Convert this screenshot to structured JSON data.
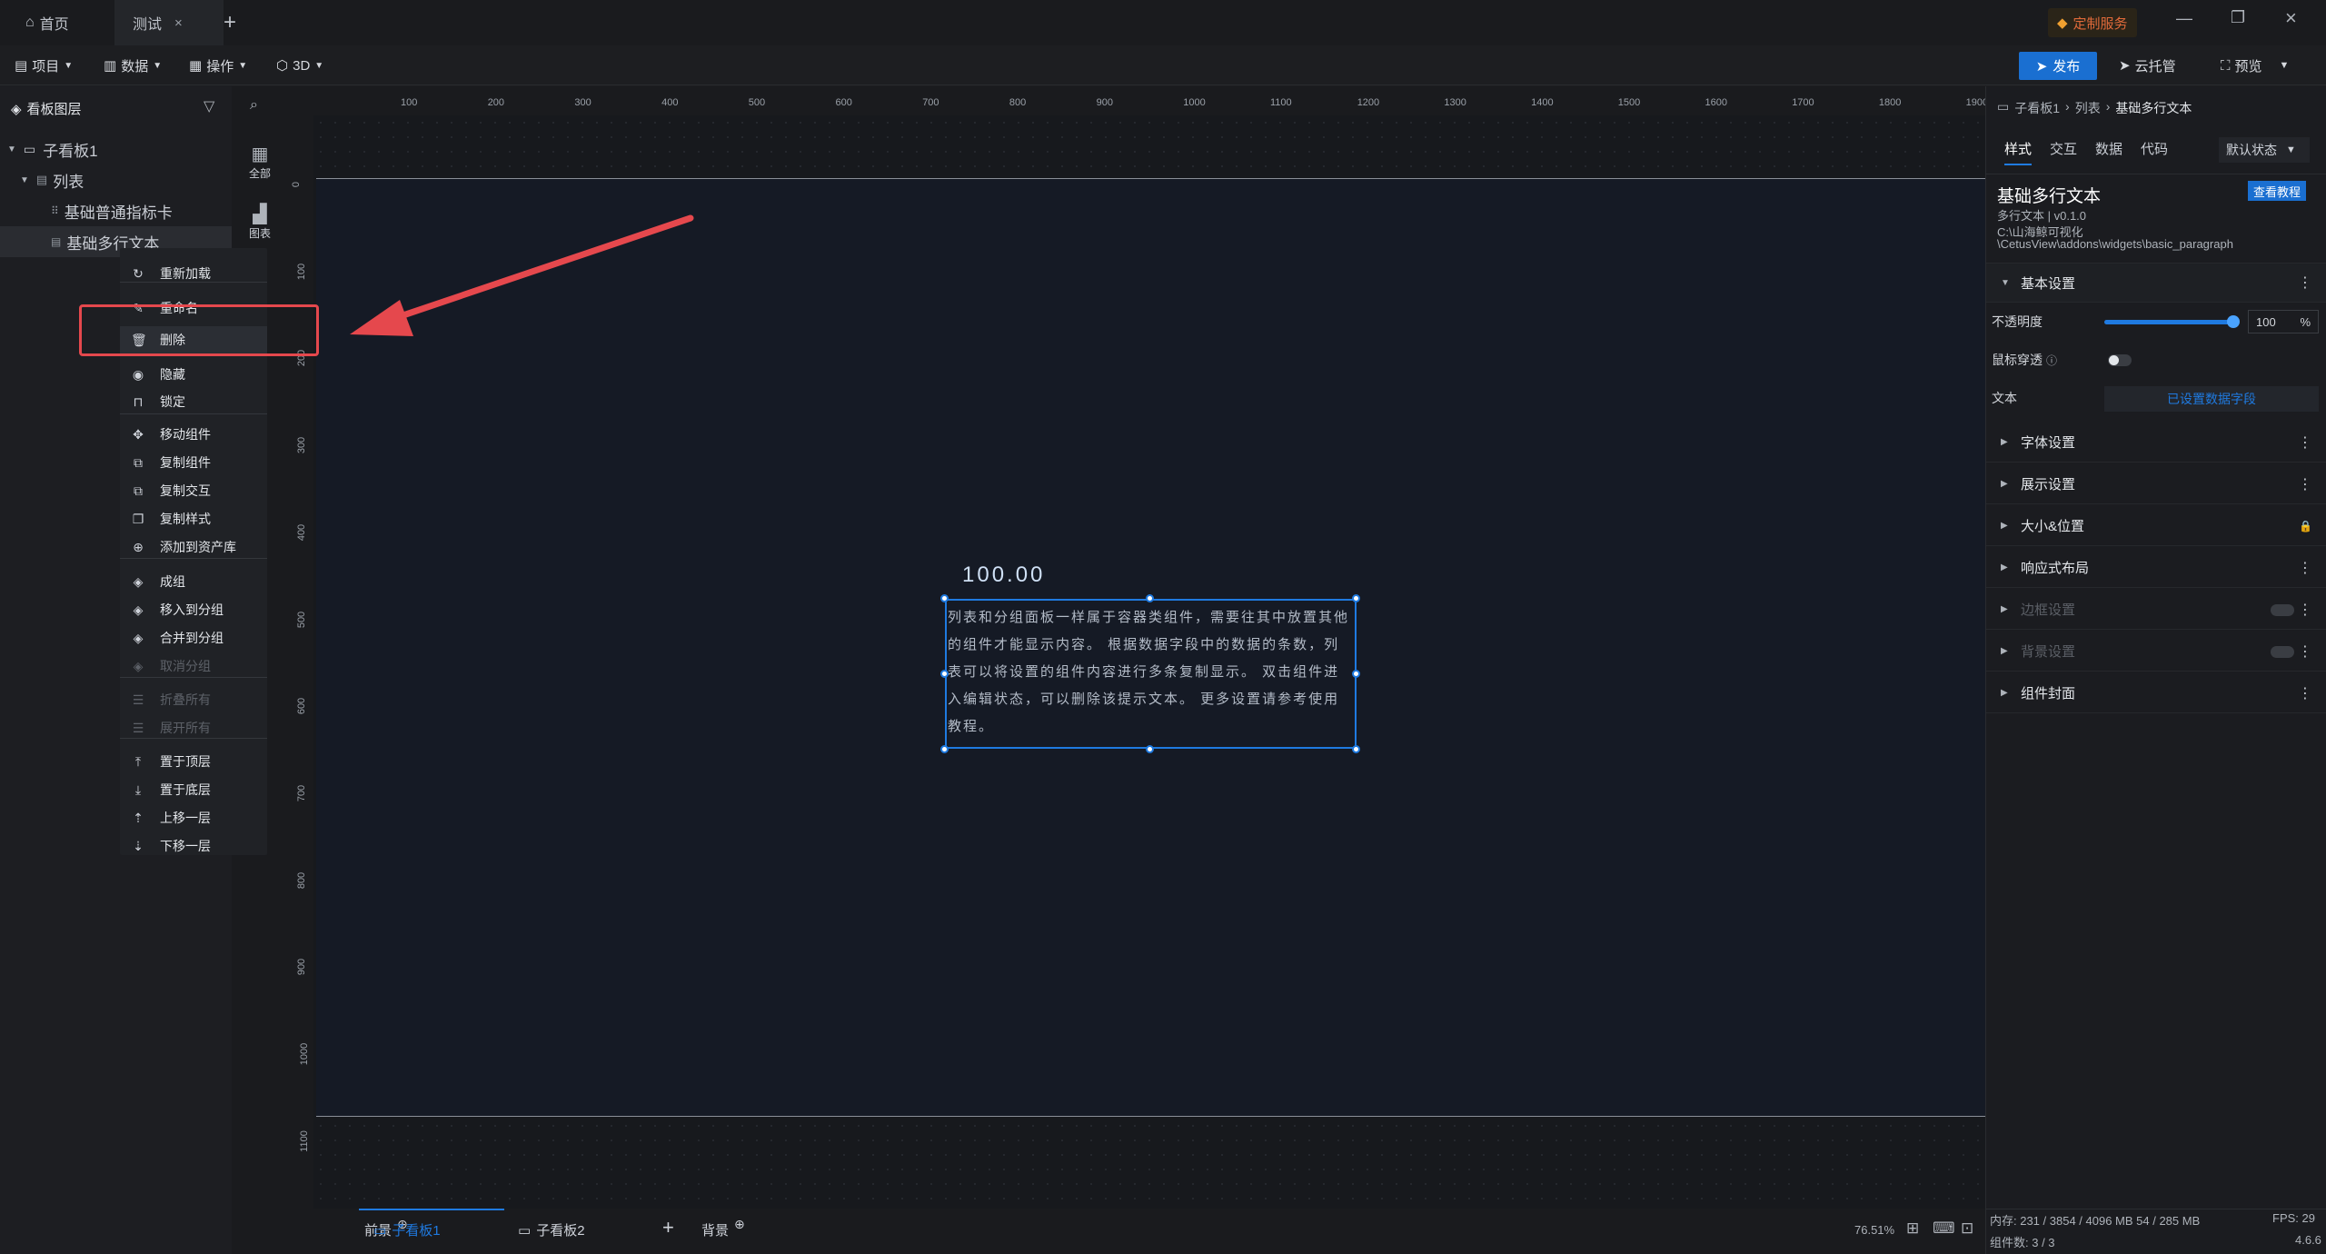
{
  "tabs": {
    "home": "首页",
    "test": "测试",
    "custom_service": "定制服务"
  },
  "toolbar": {
    "project": "项目",
    "data": "数据",
    "operate": "操作",
    "threed": "3D",
    "publish": "发布",
    "cloud": "云托管",
    "preview": "预览"
  },
  "sidebar": {
    "title": "看板图层",
    "layers": [
      "子看板1",
      "列表",
      "基础普通指标卡",
      "基础多行文本"
    ]
  },
  "strip": {
    "all": "全部",
    "chart": "图表"
  },
  "context_menu": {
    "items": [
      {
        "label": "重新加载",
        "icon": "reload-icon",
        "disabled": false
      },
      {
        "label": "重命名",
        "icon": "pencil-icon",
        "disabled": false
      },
      {
        "label": "删除",
        "icon": "trash-icon",
        "disabled": false
      },
      {
        "label": "隐藏",
        "icon": "eye-icon",
        "disabled": false
      },
      {
        "label": "锁定",
        "icon": "lock-icon",
        "disabled": false
      },
      {
        "label": "移动组件",
        "icon": "move-icon",
        "disabled": false
      },
      {
        "label": "复制组件",
        "icon": "copy-component-icon",
        "disabled": false
      },
      {
        "label": "复制交互",
        "icon": "copy-interaction-icon",
        "disabled": false
      },
      {
        "label": "复制样式",
        "icon": "copy-style-icon",
        "disabled": false
      },
      {
        "label": "添加到资产库",
        "icon": "add-asset-icon",
        "disabled": false
      },
      {
        "label": "成组",
        "icon": "group-icon",
        "disabled": false
      },
      {
        "label": "移入到分组",
        "icon": "move-into-group-icon",
        "disabled": false
      },
      {
        "label": "合并到分组",
        "icon": "merge-group-icon",
        "disabled": false
      },
      {
        "label": "取消分组",
        "icon": "ungroup-icon",
        "disabled": true
      },
      {
        "label": "折叠所有",
        "icon": "collapse-all-icon",
        "disabled": true
      },
      {
        "label": "展开所有",
        "icon": "expand-all-icon",
        "disabled": true
      },
      {
        "label": "置于顶层",
        "icon": "bring-to-top-icon",
        "disabled": false
      },
      {
        "label": "置于底层",
        "icon": "send-to-bottom-icon",
        "disabled": false
      },
      {
        "label": "上移一层",
        "icon": "move-up-icon",
        "disabled": false
      },
      {
        "label": "下移一层",
        "icon": "move-down-icon",
        "disabled": false
      }
    ]
  },
  "ruler": {
    "h": [
      "100",
      "200",
      "300",
      "400",
      "500",
      "600",
      "700",
      "800",
      "900",
      "1000",
      "1100",
      "1200",
      "1300",
      "1400",
      "1500",
      "1600",
      "1700",
      "1800",
      "1900"
    ],
    "v": [
      "0",
      "100",
      "200",
      "300",
      "400",
      "500",
      "600",
      "700",
      "800",
      "900",
      "1000",
      "1100"
    ]
  },
  "canvas": {
    "number": "100.00",
    "paragraph": "列表和分组面板一样属于容器类组件，需要往其中放置其他的组件才能显示内容。 根据数据字段中的数据的条数，列表可以将设置的组件内容进行多条复制显示。 双击组件进入编辑状态，可以删除该提示文本。 更多设置请参考使用教程。"
  },
  "bottom": {
    "front": "前景",
    "board1": "子看板1",
    "board2": "子看板2",
    "background": "背景",
    "zoom": "76.51%"
  },
  "right": {
    "breadcrumb": [
      "子看板1",
      "列表",
      "基础多行文本"
    ],
    "tabs": [
      "样式",
      "交互",
      "数据",
      "代码"
    ],
    "state": "默认状态",
    "component_title": "基础多行文本",
    "tutorial": "查看教程",
    "version": "多行文本 | v0.1.0",
    "path1": "C:\\山海鲸可视化",
    "path2": "\\CetusView\\addons\\widgets\\basic_paragraph",
    "basic_section": "基本设置",
    "opacity_label": "不透明度",
    "opacity_value": "100",
    "opacity_unit": "%",
    "opacity_level": 1.0,
    "mouse_label": "鼠标穿透",
    "text_label": "文本",
    "text_value": "已设置数据字段",
    "sections": [
      {
        "label": "字体设置",
        "disabled": false
      },
      {
        "label": "展示设置",
        "disabled": false
      },
      {
        "label": "大小&位置",
        "disabled": false
      },
      {
        "label": "响应式布局",
        "disabled": false
      },
      {
        "label": "边框设置",
        "disabled": true
      },
      {
        "label": "背景设置",
        "disabled": true
      },
      {
        "label": "组件封面",
        "disabled": false
      }
    ],
    "memory": "内存: 231 / 3854 / 4096 MB  54 / 285 MB",
    "fps": "FPS: 29",
    "components": "组件数: 3 / 3",
    "app_version": "4.6.6"
  }
}
